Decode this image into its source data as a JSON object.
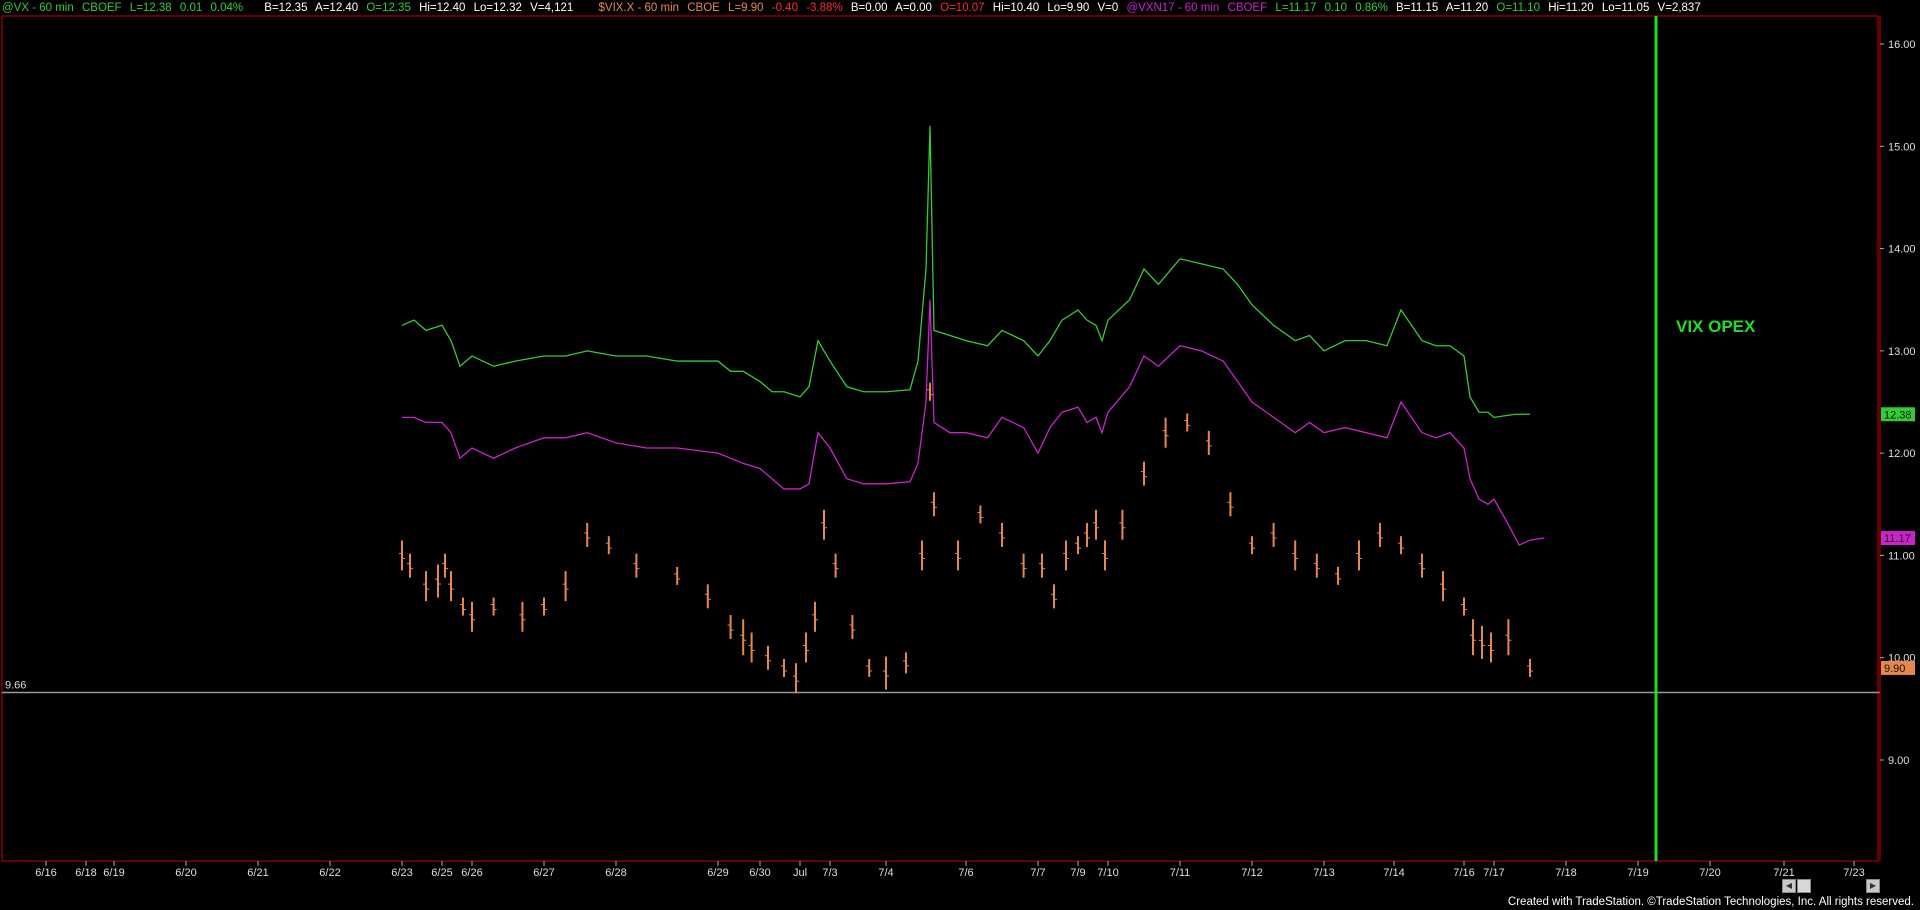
{
  "header": {
    "vx": {
      "name": "@VX - 60 min",
      "exchange": "CBOEF",
      "last": "L=12.38",
      "chg": "0.01",
      "pct": "0.04%",
      "bid": "B=12.35",
      "ask": "A=12.40",
      "open": "O=12.35",
      "hi": "Hi=12.40",
      "lo": "Lo=12.32",
      "vol": "V=4,121"
    },
    "vix": {
      "name": "$VIX.X - 60 min",
      "exchange": "CBOE",
      "last": "L=9.90",
      "chg": "-0.40",
      "pct": "-3.88%",
      "bid": "B=0.00",
      "ask": "A=0.00",
      "open": "O=10.07",
      "hi": "Hi=10.40",
      "lo": "Lo=9.90",
      "vol": "V=0"
    },
    "vxn": {
      "name": "@VXN17 - 60 min",
      "exchange": "CBOEF",
      "last": "L=11.17",
      "chg": "0.10",
      "pct": "0.86%",
      "bid": "B=11.15",
      "ask": "A=11.20",
      "open": "O=11.10",
      "hi": "Hi=11.20",
      "lo": "Lo=11.05",
      "vol": "V=2,837"
    }
  },
  "footer": "Created with TradeStation. ©TradeStation Technologies, Inc. All rights reserved.",
  "colors": {
    "vx": "#33cc33",
    "vix": "#e8874a",
    "vxn": "#cc22cc",
    "opex": "#22dd22",
    "support": "#9a9a9a",
    "frame": "#cc0000"
  },
  "chart_data": {
    "type": "line",
    "x_labels": [
      "6/16",
      "6/18",
      "6/19",
      "6/20",
      "6/21",
      "6/22",
      "6/23",
      "6/25",
      "6/26",
      "6/27",
      "6/28",
      "6/29",
      "6/30",
      "Jul",
      "7/3",
      "7/4",
      "7/6",
      "7/7",
      "7/9",
      "7/10",
      "7/11",
      "7/12",
      "7/13",
      "7/14",
      "7/16",
      "7/17",
      "7/18",
      "7/19",
      "7/20",
      "7/21",
      "7/23"
    ],
    "ylim": [
      8.2,
      16.4
    ],
    "y_ticks": [
      "9.00",
      "10.00",
      "11.00",
      "12.00",
      "13.00",
      "14.00",
      "15.00",
      "16.00"
    ],
    "series": [
      {
        "name": "@VX",
        "type": "line",
        "values": [
          [
            6.0,
            13.25
          ],
          [
            6.3,
            13.3
          ],
          [
            6.6,
            13.2
          ],
          [
            7.0,
            13.25
          ],
          [
            7.3,
            13.1
          ],
          [
            7.6,
            12.85
          ],
          [
            8.0,
            12.95
          ],
          [
            8.3,
            12.85
          ],
          [
            8.6,
            12.9
          ],
          [
            9.0,
            12.95
          ],
          [
            9.3,
            12.95
          ],
          [
            9.6,
            13.0
          ],
          [
            10.0,
            12.95
          ],
          [
            10.3,
            12.95
          ],
          [
            10.6,
            12.9
          ],
          [
            11.0,
            12.9
          ],
          [
            11.3,
            12.8
          ],
          [
            11.6,
            12.8
          ],
          [
            12.0,
            12.7
          ],
          [
            12.3,
            12.6
          ],
          [
            12.6,
            12.6
          ],
          [
            13.0,
            12.55
          ],
          [
            13.3,
            12.65
          ],
          [
            13.6,
            13.1
          ],
          [
            14.0,
            12.9
          ],
          [
            14.3,
            12.65
          ],
          [
            14.6,
            12.6
          ],
          [
            15.0,
            12.6
          ],
          [
            15.3,
            12.62
          ],
          [
            15.4,
            12.9
          ],
          [
            15.5,
            13.8
          ],
          [
            15.55,
            15.2
          ],
          [
            15.6,
            13.2
          ],
          [
            15.8,
            13.15
          ],
          [
            16.0,
            13.1
          ],
          [
            16.3,
            13.05
          ],
          [
            16.5,
            13.2
          ],
          [
            16.8,
            13.1
          ],
          [
            17.0,
            12.95
          ],
          [
            17.3,
            13.1
          ],
          [
            17.6,
            13.3
          ],
          [
            18.0,
            13.4
          ],
          [
            18.3,
            13.3
          ],
          [
            18.6,
            13.25
          ],
          [
            18.8,
            13.1
          ],
          [
            19.0,
            13.3
          ],
          [
            19.3,
            13.5
          ],
          [
            19.5,
            13.8
          ],
          [
            19.7,
            13.65
          ],
          [
            20.0,
            13.9
          ],
          [
            20.3,
            13.85
          ],
          [
            20.6,
            13.8
          ],
          [
            20.8,
            13.65
          ],
          [
            21.0,
            13.45
          ],
          [
            21.3,
            13.25
          ],
          [
            21.6,
            13.1
          ],
          [
            21.8,
            13.15
          ],
          [
            22.0,
            13.0
          ],
          [
            22.3,
            13.1
          ],
          [
            22.6,
            13.1
          ],
          [
            22.9,
            13.05
          ],
          [
            23.1,
            13.4
          ],
          [
            23.4,
            13.1
          ],
          [
            23.6,
            13.05
          ],
          [
            23.8,
            13.05
          ],
          [
            24.0,
            12.95
          ],
          [
            24.2,
            12.55
          ],
          [
            24.5,
            12.4
          ],
          [
            24.8,
            12.4
          ],
          [
            25.0,
            12.35
          ],
          [
            25.3,
            12.38
          ],
          [
            25.5,
            12.38
          ]
        ]
      },
      {
        "name": "@VXN17",
        "type": "line",
        "values": [
          [
            6.0,
            12.35
          ],
          [
            6.3,
            12.35
          ],
          [
            6.6,
            12.3
          ],
          [
            7.0,
            12.3
          ],
          [
            7.3,
            12.2
          ],
          [
            7.6,
            11.95
          ],
          [
            8.0,
            12.05
          ],
          [
            8.3,
            11.95
          ],
          [
            8.6,
            12.05
          ],
          [
            9.0,
            12.15
          ],
          [
            9.3,
            12.15
          ],
          [
            9.6,
            12.2
          ],
          [
            10.0,
            12.1
          ],
          [
            10.3,
            12.05
          ],
          [
            10.6,
            12.05
          ],
          [
            11.0,
            12.0
          ],
          [
            11.3,
            11.95
          ],
          [
            11.6,
            11.9
          ],
          [
            12.0,
            11.85
          ],
          [
            12.3,
            11.75
          ],
          [
            12.6,
            11.65
          ],
          [
            13.0,
            11.65
          ],
          [
            13.3,
            11.7
          ],
          [
            13.6,
            12.2
          ],
          [
            14.0,
            12.05
          ],
          [
            14.3,
            11.75
          ],
          [
            14.6,
            11.7
          ],
          [
            15.0,
            11.7
          ],
          [
            15.3,
            11.72
          ],
          [
            15.4,
            11.9
          ],
          [
            15.5,
            12.5
          ],
          [
            15.55,
            13.5
          ],
          [
            15.6,
            12.3
          ],
          [
            15.8,
            12.2
          ],
          [
            16.0,
            12.2
          ],
          [
            16.3,
            12.15
          ],
          [
            16.5,
            12.35
          ],
          [
            16.8,
            12.25
          ],
          [
            17.0,
            12.0
          ],
          [
            17.3,
            12.25
          ],
          [
            17.6,
            12.4
          ],
          [
            18.0,
            12.45
          ],
          [
            18.3,
            12.3
          ],
          [
            18.6,
            12.35
          ],
          [
            18.8,
            12.2
          ],
          [
            19.0,
            12.4
          ],
          [
            19.3,
            12.65
          ],
          [
            19.5,
            12.95
          ],
          [
            19.7,
            12.85
          ],
          [
            20.0,
            13.05
          ],
          [
            20.3,
            13.0
          ],
          [
            20.6,
            12.9
          ],
          [
            20.8,
            12.7
          ],
          [
            21.0,
            12.5
          ],
          [
            21.3,
            12.35
          ],
          [
            21.6,
            12.2
          ],
          [
            21.8,
            12.3
          ],
          [
            22.0,
            12.2
          ],
          [
            22.3,
            12.25
          ],
          [
            22.6,
            12.2
          ],
          [
            22.9,
            12.15
          ],
          [
            23.1,
            12.5
          ],
          [
            23.4,
            12.2
          ],
          [
            23.6,
            12.15
          ],
          [
            23.8,
            12.2
          ],
          [
            24.0,
            12.05
          ],
          [
            24.2,
            11.75
          ],
          [
            24.5,
            11.55
          ],
          [
            24.8,
            11.5
          ],
          [
            25.0,
            11.55
          ],
          [
            25.2,
            11.3
          ],
          [
            25.35,
            11.1
          ],
          [
            25.5,
            11.15
          ],
          [
            25.7,
            11.17
          ]
        ]
      },
      {
        "name": "$VIX.X",
        "type": "bar-ohlc",
        "values": [
          [
            6.0,
            11.0
          ],
          [
            6.2,
            10.9
          ],
          [
            6.6,
            10.7
          ],
          [
            6.9,
            10.75
          ],
          [
            7.1,
            10.9
          ],
          [
            7.3,
            10.7
          ],
          [
            7.7,
            10.5
          ],
          [
            8.0,
            10.4
          ],
          [
            8.3,
            10.5
          ],
          [
            8.7,
            10.4
          ],
          [
            9.0,
            10.5
          ],
          [
            9.3,
            10.7
          ],
          [
            9.6,
            11.2
          ],
          [
            9.9,
            11.1
          ],
          [
            10.2,
            10.9
          ],
          [
            10.6,
            10.8
          ],
          [
            10.9,
            10.6
          ],
          [
            11.3,
            10.3
          ],
          [
            11.6,
            10.2
          ],
          [
            11.8,
            10.1
          ],
          [
            12.2,
            10.0
          ],
          [
            12.6,
            9.9
          ],
          [
            12.9,
            9.8
          ],
          [
            13.2,
            10.1
          ],
          [
            13.5,
            10.4
          ],
          [
            13.8,
            11.3
          ],
          [
            14.1,
            10.9
          ],
          [
            14.4,
            10.3
          ],
          [
            14.7,
            9.9
          ],
          [
            15.0,
            9.85
          ],
          [
            15.25,
            9.95
          ],
          [
            15.45,
            11.0
          ],
          [
            15.55,
            12.6
          ],
          [
            15.6,
            11.5
          ],
          [
            15.9,
            11.0
          ],
          [
            16.2,
            11.4
          ],
          [
            16.5,
            11.2
          ],
          [
            16.8,
            10.9
          ],
          [
            17.1,
            10.9
          ],
          [
            17.4,
            10.6
          ],
          [
            17.7,
            11.0
          ],
          [
            18.0,
            11.1
          ],
          [
            18.3,
            11.2
          ],
          [
            18.6,
            11.3
          ],
          [
            18.9,
            11.0
          ],
          [
            19.2,
            11.3
          ],
          [
            19.5,
            11.8
          ],
          [
            19.8,
            12.2
          ],
          [
            20.1,
            12.3
          ],
          [
            20.4,
            12.1
          ],
          [
            20.7,
            11.5
          ],
          [
            21.0,
            11.1
          ],
          [
            21.3,
            11.2
          ],
          [
            21.6,
            11.0
          ],
          [
            21.9,
            10.9
          ],
          [
            22.2,
            10.8
          ],
          [
            22.5,
            11.0
          ],
          [
            22.8,
            11.2
          ],
          [
            23.1,
            11.1
          ],
          [
            23.4,
            10.9
          ],
          [
            23.7,
            10.7
          ],
          [
            24.0,
            10.5
          ],
          [
            24.3,
            10.2
          ],
          [
            24.6,
            10.15
          ],
          [
            24.9,
            10.1
          ],
          [
            25.2,
            10.2
          ],
          [
            25.5,
            9.9
          ]
        ]
      }
    ],
    "annotations": [
      {
        "text": "VIX OPEX",
        "at_x_label": "7/19"
      },
      {
        "text": "9.66",
        "type": "horizontal-line",
        "y": 9.66
      }
    ],
    "last_value_labels": [
      {
        "series": "@VX",
        "value": "12.38"
      },
      {
        "series": "@VXN17",
        "value": "11.17"
      },
      {
        "series": "$VIX.X",
        "value": "9.90"
      }
    ]
  }
}
